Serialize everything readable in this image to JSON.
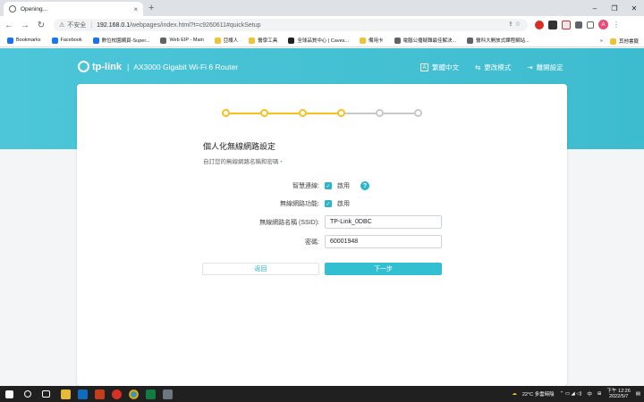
{
  "browser": {
    "tab_title": "Opening...",
    "tab_close": "×",
    "new_tab": "+",
    "window_controls": [
      "–",
      "❐",
      "✕"
    ],
    "url_warning": "⚠",
    "url_insecure_label": "不安全",
    "url_host": "192.168.0.1",
    "url_path": "/webpages/index.html?t=c9260611#quickSetup",
    "bookmarks": [
      {
        "label": "Bookmarks",
        "color": "#1a73e8"
      },
      {
        "label": "Facebook",
        "color": "#1877f2"
      },
      {
        "label": "數位校園網頁-Super...",
        "color": "#1a73e8"
      },
      {
        "label": "Web EIP - Main",
        "color": "#5f6368"
      },
      {
        "label": "亞護人",
        "color": "#f1c232"
      },
      {
        "label": "醫學工具",
        "color": "#f1c232"
      },
      {
        "label": "全球品質中心 | Caves...",
        "color": "#222222"
      },
      {
        "label": "備用卡",
        "color": "#f1c232"
      },
      {
        "label": "電腦公播疑難最佳解決...",
        "color": "#5f6368"
      },
      {
        "label": "醫科大開放式課程網站...",
        "color": "#5f6368"
      }
    ],
    "bookmarks_more": "»",
    "other_bookmarks": "其他書籤",
    "profile_initial": "A"
  },
  "router": {
    "brand": "tp-link",
    "model": "AX3000 Gigabit Wi-Fi 6 Router",
    "nav": [
      {
        "icon": "A",
        "label": "繁體中文"
      },
      {
        "icon": "⇆",
        "label": "更改模式"
      },
      {
        "icon": "⇥",
        "label": "離開設定"
      }
    ],
    "progress": {
      "total_steps": 6,
      "completed_steps": 4,
      "done_color": "#f6c01e",
      "todo_color": "#c8c8c8"
    },
    "heading": "個人化無線網路設定",
    "subheading": "自訂您的無線網路名稱和密碼",
    "required_mark": "•",
    "smart_connect": {
      "label": "智慧連線:",
      "checkbox": "啟用",
      "checked": true,
      "help": "?"
    },
    "wireless": {
      "label": "無線網路功能:",
      "checkbox": "啟用",
      "checked": true
    },
    "ssid": {
      "label": "無線網路名稱 (SSID):",
      "value": "TP-Link_0DBC"
    },
    "password": {
      "label": "密碼:",
      "value": "60001948"
    },
    "back_button": "返回",
    "next_button": "下一步",
    "accent_color": "#33bfd2"
  },
  "taskbar": {
    "weather": "22°C  多雲時陰",
    "lang": "中",
    "time": "下午 12:26",
    "date": "2022/5/7"
  }
}
